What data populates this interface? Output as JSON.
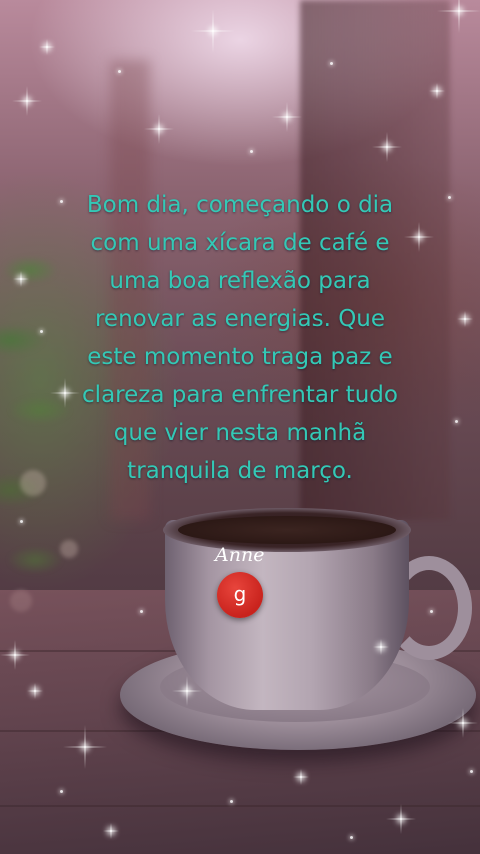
{
  "message": {
    "text": "Bom dia, começando o dia\ncom uma xícara de café e\numa boa reflexão para\nrenovar as energias. Que\neste momento traga paz e\nclareza para enfrentar tudo\nque vier nesta manhã\ntranquila de março."
  },
  "signature": {
    "text": "Anne"
  },
  "badge": {
    "letter": "g"
  },
  "colors": {
    "quote_text": "#33c9b6",
    "badge": "#d9302a",
    "signature": "#ffffff"
  }
}
